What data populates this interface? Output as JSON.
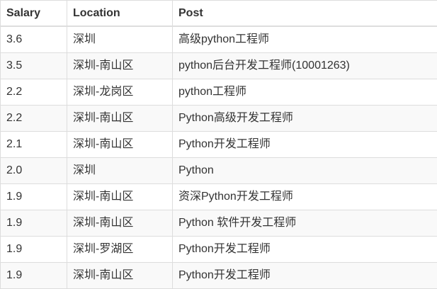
{
  "table": {
    "headers": [
      "Salary",
      "Location",
      "Post"
    ],
    "rows": [
      {
        "salary": "3.6",
        "location": "深圳",
        "post": "高级python工程师"
      },
      {
        "salary": "3.5",
        "location": "深圳-南山区",
        "post": "python后台开发工程师(10001263)"
      },
      {
        "salary": "2.2",
        "location": "深圳-龙岗区",
        "post": "python工程师"
      },
      {
        "salary": "2.2",
        "location": "深圳-南山区",
        "post": "Python高级开发工程师"
      },
      {
        "salary": "2.1",
        "location": "深圳-南山区",
        "post": "Python开发工程师"
      },
      {
        "salary": "2.0",
        "location": "深圳",
        "post": "Python"
      },
      {
        "salary": "1.9",
        "location": "深圳-南山区",
        "post": "资深Python开发工程师"
      },
      {
        "salary": "1.9",
        "location": "深圳-南山区",
        "post": "Python 软件开发工程师"
      },
      {
        "salary": "1.9",
        "location": "深圳-罗湖区",
        "post": "Python开发工程师"
      },
      {
        "salary": "1.9",
        "location": "深圳-南山区",
        "post": "Python开发工程师"
      }
    ]
  },
  "colors": {
    "border": "#dddddd",
    "stripe": "#f9f9f9",
    "text": "#333333"
  }
}
